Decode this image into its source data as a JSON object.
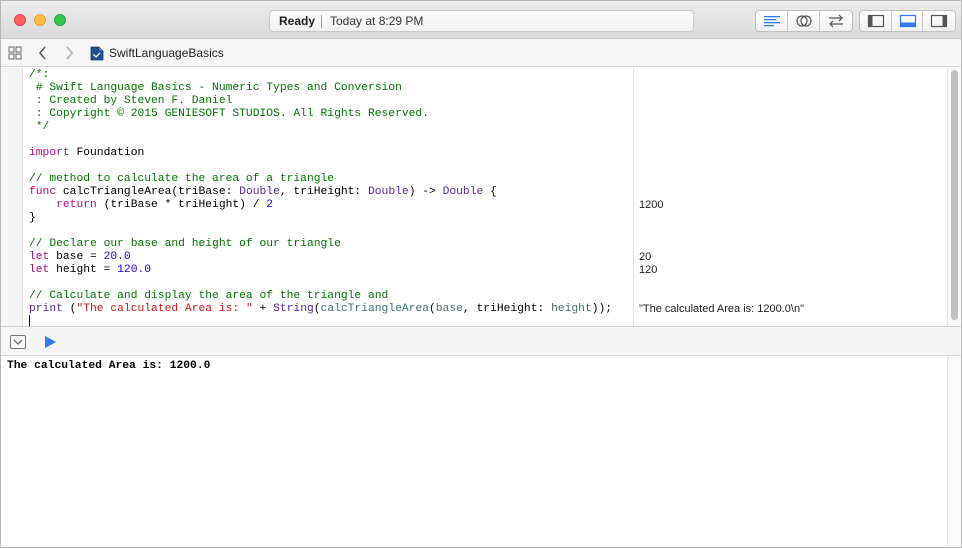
{
  "titlebar": {
    "status": "Ready",
    "time": "Today at 8:29 PM"
  },
  "jumpbar": {
    "file": "SwiftLanguageBasics"
  },
  "code": {
    "lines": [
      [
        {
          "t": "/*:",
          "c": "cm"
        }
      ],
      [
        {
          "t": " # Swift Language Basics - Numeric Types and Conversion",
          "c": "cm"
        }
      ],
      [
        {
          "t": " : Created by Steven F. Daniel",
          "c": "cm"
        }
      ],
      [
        {
          "t": " : Copyright © 2015 GENIESOFT STUDIOS. All Rights Reserved.",
          "c": "cm"
        }
      ],
      [
        {
          "t": " */",
          "c": "cm"
        }
      ],
      [],
      [
        {
          "t": "import",
          "c": "kw"
        },
        {
          "t": " Foundation",
          "c": "pl"
        }
      ],
      [],
      [
        {
          "t": "// method to calculate the area of a triangle",
          "c": "cm"
        }
      ],
      [
        {
          "t": "func",
          "c": "kw"
        },
        {
          "t": " calcTriangleArea(triBase: ",
          "c": "pl"
        },
        {
          "t": "Double",
          "c": "ty"
        },
        {
          "t": ", triHeight: ",
          "c": "pl"
        },
        {
          "t": "Double",
          "c": "ty"
        },
        {
          "t": ") -> ",
          "c": "pl"
        },
        {
          "t": "Double",
          "c": "ty"
        },
        {
          "t": " {",
          "c": "pl"
        }
      ],
      [
        {
          "t": "    ",
          "c": "pl"
        },
        {
          "t": "return",
          "c": "kw"
        },
        {
          "t": " (triBase * triHeight) / ",
          "c": "pl"
        },
        {
          "t": "2",
          "c": "num"
        }
      ],
      [
        {
          "t": "}",
          "c": "pl"
        }
      ],
      [],
      [
        {
          "t": "// Declare our base and height of our triangle",
          "c": "cm"
        }
      ],
      [
        {
          "t": "let",
          "c": "kw"
        },
        {
          "t": " base = ",
          "c": "pl"
        },
        {
          "t": "20.0",
          "c": "num"
        }
      ],
      [
        {
          "t": "let",
          "c": "kw"
        },
        {
          "t": " height = ",
          "c": "pl"
        },
        {
          "t": "120.0",
          "c": "num"
        }
      ],
      [],
      [
        {
          "t": "// Calculate and display the area of the triangle and",
          "c": "cm"
        }
      ],
      [
        {
          "t": "print",
          "c": "ty"
        },
        {
          "t": " (",
          "c": "pl"
        },
        {
          "t": "\"The calculated Area is: \"",
          "c": "str"
        },
        {
          "t": " + ",
          "c": "pl"
        },
        {
          "t": "String",
          "c": "ty"
        },
        {
          "t": "(",
          "c": "pl"
        },
        {
          "t": "calcTriangleArea",
          "c": "fn"
        },
        {
          "t": "(",
          "c": "pl"
        },
        {
          "t": "base",
          "c": "fn"
        },
        {
          "t": ", triHeight: ",
          "c": "pl"
        },
        {
          "t": "height",
          "c": "fn"
        },
        {
          "t": "));",
          "c": "pl"
        }
      ]
    ]
  },
  "results": [
    {
      "line": 10,
      "text": "1200"
    },
    {
      "line": 14,
      "text": "20"
    },
    {
      "line": 15,
      "text": "120"
    },
    {
      "line": 18,
      "text": "\"The calculated Area is: 1200.0\\n\""
    }
  ],
  "console": {
    "output": "The calculated Area is: 1200.0"
  },
  "icons": {
    "navigator": "grid-icon",
    "back": "chevron-left-icon",
    "forward": "chevron-right-icon",
    "file": "swift-file-icon",
    "hide_debug": "hide-debug-area-icon",
    "run": "play-icon"
  },
  "colors": {
    "comment": "#007400",
    "keyword": "#aa0d91",
    "number": "#1c00cf",
    "string": "#c41a16",
    "type": "#5c2699",
    "accent": "#2f7cf6"
  }
}
